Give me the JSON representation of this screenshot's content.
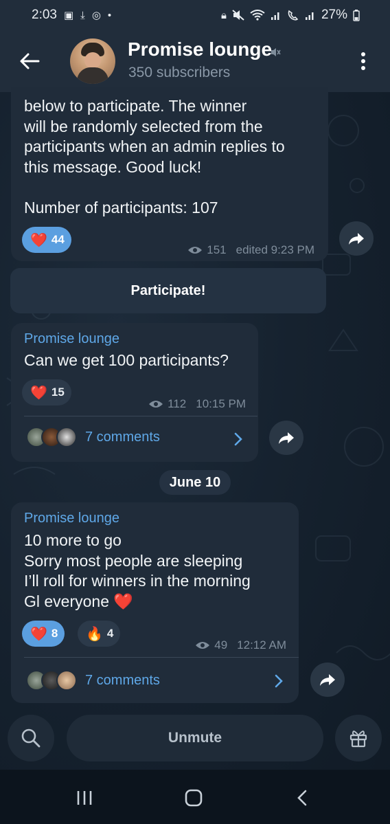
{
  "status_bar": {
    "time": "2:03",
    "battery": "27%",
    "left_icons": [
      "gallery-icon",
      "download-icon",
      "instagram-icon",
      "dot-icon"
    ],
    "right_icons": [
      "lock-icon",
      "mute-icon",
      "wifi-icon",
      "signal-icon",
      "call-icon",
      "signal-icon",
      "battery-icon"
    ]
  },
  "header": {
    "title": "Promise lounge",
    "subtitle": "350 subscribers"
  },
  "messages": [
    {
      "text": "below to participate. The winner\nwill be randomly selected from the\nparticipants when an admin replies to\nthis message. Good luck!\n\nNumber of participants: 107",
      "reactions": [
        {
          "emoji": "❤️",
          "count": "44",
          "mine": true
        }
      ],
      "views": "151",
      "time": "edited 9:23 PM"
    },
    {
      "sender": "Promise lounge",
      "text": "Can we get 100 participants?",
      "reactions": [
        {
          "emoji": "❤️",
          "count": "15",
          "mine": false
        }
      ],
      "views": "112",
      "time": "10:15 PM",
      "comments": "7 comments"
    },
    {
      "sender": "Promise lounge",
      "text": "10 more to go\nSorry most people are sleeping\nI’ll roll for winners in the morning\nGl everyone ❤️",
      "reactions": [
        {
          "emoji": "❤️",
          "count": "8",
          "mine": true
        },
        {
          "emoji": "🔥",
          "count": "4",
          "mine": false
        }
      ],
      "views": "49",
      "time": "12:12 AM",
      "comments": "7 comments"
    }
  ],
  "inline_button": "Participate!",
  "date_separator": "June 10",
  "bottom_bar": {
    "unmute_label": "Unmute"
  },
  "colors": {
    "header_bg": "#212d3b",
    "bubble_bg": "#202c3a",
    "accent": "#5fa8e8",
    "reaction_mine": "#5b9fe0"
  }
}
